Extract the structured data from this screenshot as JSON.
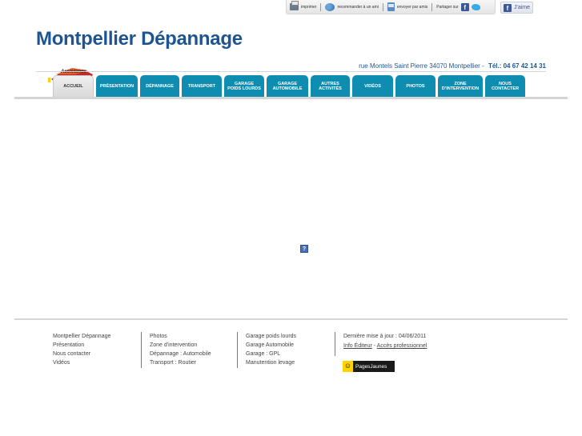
{
  "utility": {
    "print": "imprimer",
    "recommend": "recommander à un ami",
    "send_friend": "envoyer par amis",
    "share_on": "Partager sur",
    "like": "J'aime"
  },
  "icons": [
    "printer-icon",
    "friends-icon",
    "mail-icon",
    "facebook-icon",
    "twitter-icon"
  ],
  "header": {
    "title": "Montpellier Dépannage",
    "address": "rue Montels Saint Pierre 34070 Montpellier  -",
    "tel": "Tél.: 04 67 42 14 31",
    "logo_text": "Assistance"
  },
  "nav": [
    {
      "label": "ACCUEIL",
      "label2": "",
      "active": true
    },
    {
      "label": "PRÉSENTATION",
      "label2": ""
    },
    {
      "label": "DÉPANNAGE",
      "label2": ""
    },
    {
      "label": "TRANSPORT",
      "label2": ""
    },
    {
      "label": "GARAGE",
      "label2": "POIDS LOURDS"
    },
    {
      "label": "GARAGE",
      "label2": "AUTOMOBILE"
    },
    {
      "label": "AUTRES",
      "label2": "ACTIVITÉS"
    },
    {
      "label": "VIDÉOS",
      "label2": ""
    },
    {
      "label": "PHOTOS",
      "label2": ""
    },
    {
      "label": "ZONE",
      "label2": "D'INTERVENTION"
    },
    {
      "label": "NOUS",
      "label2": "CONTACTER"
    }
  ],
  "footer": {
    "col1": [
      "Montpellier Dépannage",
      "Présentation",
      "Nous contacter",
      "Vidéos"
    ],
    "col2": [
      "Photos",
      "Zone d'intervention",
      "Dépannage : Automobile",
      "Transport : Routier"
    ],
    "col3": [
      "Garage poids lourds",
      "Garage Automobile",
      "Garage : GPL",
      "Manutention levage"
    ],
    "updated": "Dernière mise à jour : 04/06/2011",
    "info_editeur": "Info Éditeur",
    "dash": "-",
    "acces_pro": "Accès professionnel",
    "pages_jaunes": "PagesJaunes"
  },
  "colors": {
    "brand": "#1d5591",
    "tab": "#0e8db0"
  }
}
